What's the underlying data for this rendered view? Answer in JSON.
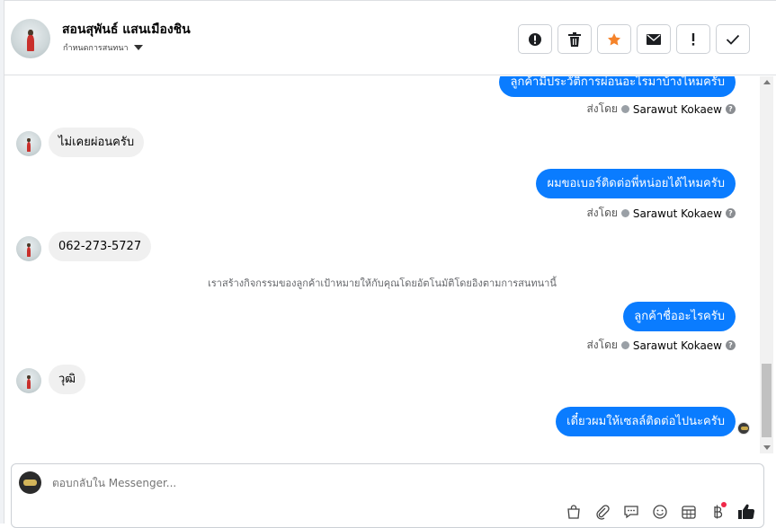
{
  "contact": {
    "name": "สอนสุพันธ์ แสนเมืองชิน",
    "status": "กำหนดการสนทนา"
  },
  "actions": [
    {
      "name": "spam-button",
      "icon": "alert-circle-icon"
    },
    {
      "name": "delete-button",
      "icon": "trash-icon"
    },
    {
      "name": "star-button",
      "icon": "star-icon"
    },
    {
      "name": "mark-unread-button",
      "icon": "envelope-icon"
    },
    {
      "name": "follow-up-button",
      "icon": "exclamation-icon"
    },
    {
      "name": "done-button",
      "icon": "check-icon"
    }
  ],
  "messages": [
    {
      "direction": "out",
      "text": "ลูกค้ามีประวัติการผ่อนอะไรมาบ้างไหมครับ",
      "sent_by_label": "ส่งโดย",
      "sender": "Sarawut Kokaew"
    },
    {
      "direction": "in",
      "text": "ไม่เคยผ่อนครับ"
    },
    {
      "direction": "out",
      "text": "ผมขอเบอร์ติดต่อพี่หน่อยได้ไหมครับ",
      "sent_by_label": "ส่งโดย",
      "sender": "Sarawut Kokaew"
    },
    {
      "direction": "in",
      "text": "062-273-5727"
    },
    {
      "system": "เราสร้างกิจกรรมของลูกค้าเป้าหมายให้กับคุณโดยอัตโนมัติโดยอิงตามการสนทนานี้"
    },
    {
      "direction": "out",
      "text": "ลูกค้าชื่ออะไรครับ",
      "sent_by_label": "ส่งโดย",
      "sender": "Sarawut Kokaew"
    },
    {
      "direction": "in",
      "text": "วุฒิ"
    },
    {
      "direction": "out",
      "text": "เดี๋ยวผมให้เซลล์ติดต่อไปนะครับ"
    }
  ],
  "composer": {
    "placeholder": "ตอบกลับใน Messenger...",
    "tools": [
      "shopping-bag-icon",
      "paperclip-icon",
      "saved-reply-icon",
      "emoji-icon",
      "calendar-icon",
      "baht-icon",
      "like-icon"
    ]
  },
  "colors": {
    "accent": "#0a7cff",
    "star": "#f5832a",
    "badge": "#f02849"
  }
}
